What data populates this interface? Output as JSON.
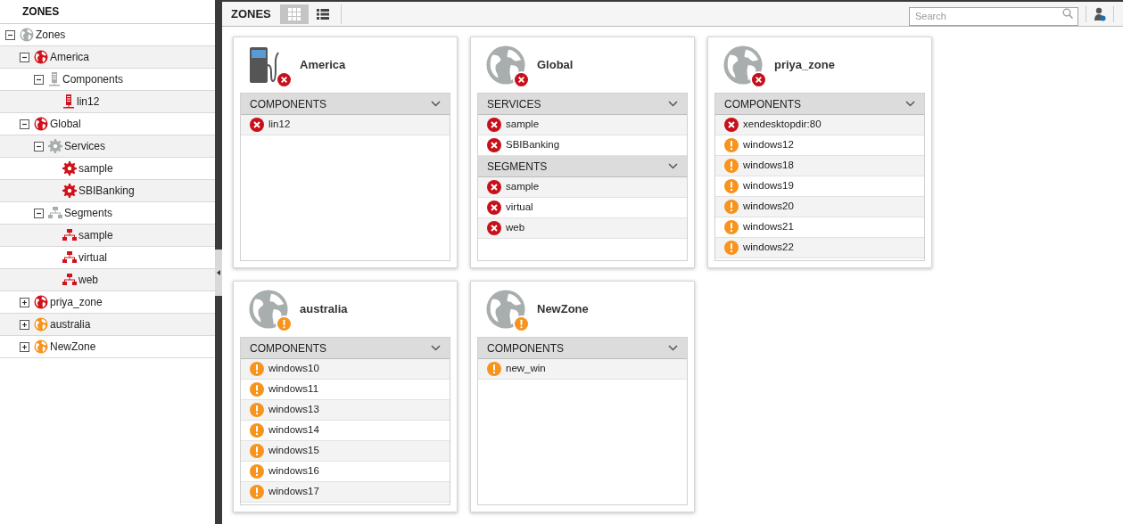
{
  "sidebar": {
    "title": "ZONES",
    "tree": [
      {
        "label": "Zones",
        "kind": "globe",
        "color": "#a8aeae",
        "expanded": true,
        "children": [
          {
            "label": "America",
            "kind": "globe",
            "color": "#d0121b",
            "expanded": true,
            "children": [
              {
                "label": "Components",
                "kind": "server",
                "color": "#a8aeae",
                "expanded": true,
                "children": [
                  {
                    "label": "lin12",
                    "kind": "server",
                    "color": "#d0121b"
                  }
                ]
              }
            ]
          },
          {
            "label": "Global",
            "kind": "globe",
            "color": "#d0121b",
            "expanded": true,
            "children": [
              {
                "label": "Services",
                "kind": "gear",
                "color": "#a8aeae",
                "expanded": true,
                "children": [
                  {
                    "label": "sample",
                    "kind": "gear",
                    "color": "#d0121b"
                  },
                  {
                    "label": "SBIBanking",
                    "kind": "gear",
                    "color": "#d0121b"
                  }
                ]
              },
              {
                "label": "Segments",
                "kind": "network",
                "color": "#a8aeae",
                "expanded": true,
                "children": [
                  {
                    "label": "sample",
                    "kind": "network",
                    "color": "#d0121b"
                  },
                  {
                    "label": "virtual",
                    "kind": "network",
                    "color": "#d0121b"
                  },
                  {
                    "label": "web",
                    "kind": "network",
                    "color": "#d0121b"
                  }
                ]
              }
            ]
          },
          {
            "label": "priya_zone",
            "kind": "globe",
            "color": "#d0121b",
            "expanded": false
          },
          {
            "label": "australia",
            "kind": "globe",
            "color": "#f7931e",
            "expanded": false
          },
          {
            "label": "NewZone",
            "kind": "globe",
            "color": "#f7931e",
            "expanded": false
          }
        ]
      }
    ]
  },
  "toolbar": {
    "title": "ZONES",
    "views": [
      {
        "kind": "grid",
        "selected": true
      },
      {
        "kind": "list",
        "selected": false
      }
    ],
    "search": {
      "placeholder": "Search"
    }
  },
  "cards": [
    {
      "name": "America",
      "kind": "pump",
      "badge": {
        "kind": "error"
      },
      "sections": [
        {
          "title": "COMPONENTS",
          "items": [
            {
              "label": "lin12",
              "kind": "error"
            }
          ]
        }
      ]
    },
    {
      "name": "Global",
      "kind": "globe",
      "badge": {
        "kind": "error"
      },
      "sections": [
        {
          "title": "SERVICES",
          "items": [
            {
              "label": "sample",
              "kind": "error"
            },
            {
              "label": "SBIBanking",
              "kind": "error"
            }
          ]
        },
        {
          "title": "SEGMENTS",
          "items": [
            {
              "label": "sample",
              "kind": "error"
            },
            {
              "label": "virtual",
              "kind": "error"
            },
            {
              "label": "web",
              "kind": "error"
            }
          ]
        }
      ]
    },
    {
      "name": "priya_zone",
      "kind": "globe",
      "badge": {
        "kind": "error"
      },
      "sections": [
        {
          "title": "COMPONENTS",
          "items": [
            {
              "label": "xendesktopdir:80",
              "kind": "error"
            },
            {
              "label": "windows12",
              "kind": "warning"
            },
            {
              "label": "windows18",
              "kind": "warning"
            },
            {
              "label": "windows19",
              "kind": "warning"
            },
            {
              "label": "windows20",
              "kind": "warning"
            },
            {
              "label": "windows21",
              "kind": "warning"
            },
            {
              "label": "windows22",
              "kind": "warning"
            }
          ]
        }
      ]
    },
    {
      "name": "australia",
      "kind": "globe",
      "badge": {
        "kind": "warning"
      },
      "sections": [
        {
          "title": "COMPONENTS",
          "items": [
            {
              "label": "windows10",
              "kind": "warning"
            },
            {
              "label": "windows11",
              "kind": "warning"
            },
            {
              "label": "windows13",
              "kind": "warning"
            },
            {
              "label": "windows14",
              "kind": "warning"
            },
            {
              "label": "windows15",
              "kind": "warning"
            },
            {
              "label": "windows16",
              "kind": "warning"
            },
            {
              "label": "windows17",
              "kind": "warning"
            }
          ]
        }
      ]
    },
    {
      "name": "NewZone",
      "kind": "globe",
      "badge": {
        "kind": "warning"
      },
      "sections": [
        {
          "title": "COMPONENTS",
          "items": [
            {
              "label": "new_win",
              "kind": "warning"
            }
          ]
        }
      ]
    }
  ]
}
